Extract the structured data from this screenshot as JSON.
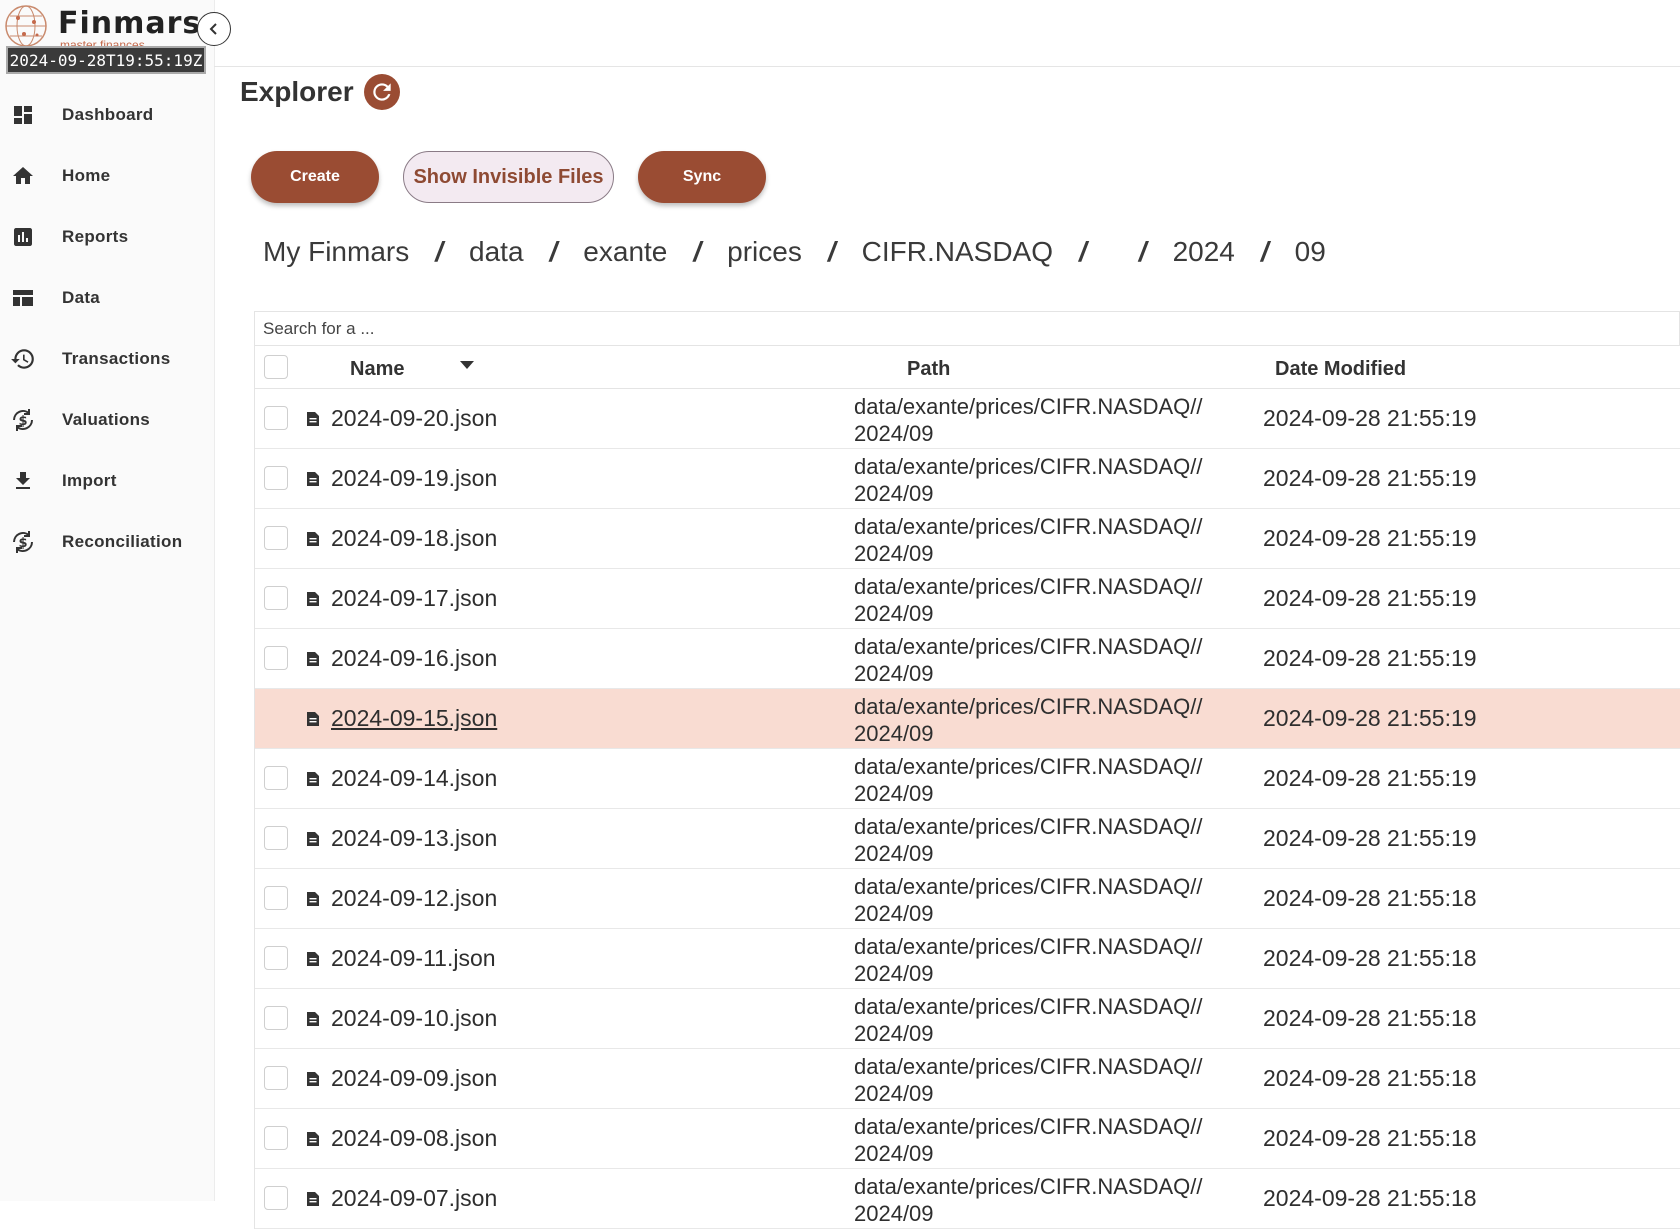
{
  "brand": {
    "name": "Finmars",
    "tagline": "master finances",
    "timestamp": "2024-09-28T19:55:19Z"
  },
  "nav": [
    {
      "label": "Dashboard",
      "icon": "dashboard-icon"
    },
    {
      "label": "Home",
      "icon": "home-icon"
    },
    {
      "label": "Reports",
      "icon": "reports-icon"
    },
    {
      "label": "Data",
      "icon": "data-icon"
    },
    {
      "label": "Transactions",
      "icon": "history-icon"
    },
    {
      "label": "Valuations",
      "icon": "currency-sync-icon"
    },
    {
      "label": "Import",
      "icon": "download-icon"
    },
    {
      "label": "Reconciliation",
      "icon": "currency-sync-icon"
    }
  ],
  "page": {
    "title": "Explorer"
  },
  "toolbar": {
    "create_label": "Create",
    "invisible_label": "Show Invisible Files",
    "sync_label": "Sync"
  },
  "breadcrumb": [
    "My Finmars",
    "data",
    "exante",
    "prices",
    "CIFR.NASDAQ",
    "",
    "2024",
    "09"
  ],
  "search": {
    "placeholder": "Search for a ..."
  },
  "table": {
    "headers": {
      "name": "Name",
      "path": "Path",
      "date": "Date Modified"
    },
    "highlight_index": 5,
    "rows": [
      {
        "name": "2024-09-20.json",
        "path_1": "data/exante/prices/CIFR.NASDAQ//",
        "path_2": "2024/09",
        "date": "2024-09-28 21:55:19"
      },
      {
        "name": "2024-09-19.json",
        "path_1": "data/exante/prices/CIFR.NASDAQ//",
        "path_2": "2024/09",
        "date": "2024-09-28 21:55:19"
      },
      {
        "name": "2024-09-18.json",
        "path_1": "data/exante/prices/CIFR.NASDAQ//",
        "path_2": "2024/09",
        "date": "2024-09-28 21:55:19"
      },
      {
        "name": "2024-09-17.json",
        "path_1": "data/exante/prices/CIFR.NASDAQ//",
        "path_2": "2024/09",
        "date": "2024-09-28 21:55:19"
      },
      {
        "name": "2024-09-16.json",
        "path_1": "data/exante/prices/CIFR.NASDAQ//",
        "path_2": "2024/09",
        "date": "2024-09-28 21:55:19"
      },
      {
        "name": "2024-09-15.json",
        "path_1": "data/exante/prices/CIFR.NASDAQ//",
        "path_2": "2024/09",
        "date": "2024-09-28 21:55:19"
      },
      {
        "name": "2024-09-14.json",
        "path_1": "data/exante/prices/CIFR.NASDAQ//",
        "path_2": "2024/09",
        "date": "2024-09-28 21:55:19"
      },
      {
        "name": "2024-09-13.json",
        "path_1": "data/exante/prices/CIFR.NASDAQ//",
        "path_2": "2024/09",
        "date": "2024-09-28 21:55:19"
      },
      {
        "name": "2024-09-12.json",
        "path_1": "data/exante/prices/CIFR.NASDAQ//",
        "path_2": "2024/09",
        "date": "2024-09-28 21:55:18"
      },
      {
        "name": "2024-09-11.json",
        "path_1": "data/exante/prices/CIFR.NASDAQ//",
        "path_2": "2024/09",
        "date": "2024-09-28 21:55:18"
      },
      {
        "name": "2024-09-10.json",
        "path_1": "data/exante/prices/CIFR.NASDAQ//",
        "path_2": "2024/09",
        "date": "2024-09-28 21:55:18"
      },
      {
        "name": "2024-09-09.json",
        "path_1": "data/exante/prices/CIFR.NASDAQ//",
        "path_2": "2024/09",
        "date": "2024-09-28 21:55:18"
      },
      {
        "name": "2024-09-08.json",
        "path_1": "data/exante/prices/CIFR.NASDAQ//",
        "path_2": "2024/09",
        "date": "2024-09-28 21:55:18"
      },
      {
        "name": "2024-09-07.json",
        "path_1": "data/exante/prices/CIFR.NASDAQ//",
        "path_2": "2024/09",
        "date": "2024-09-28 21:55:18"
      }
    ]
  },
  "colors": {
    "accent": "#9a4c33",
    "highlight_row": "#f9dcd2"
  }
}
